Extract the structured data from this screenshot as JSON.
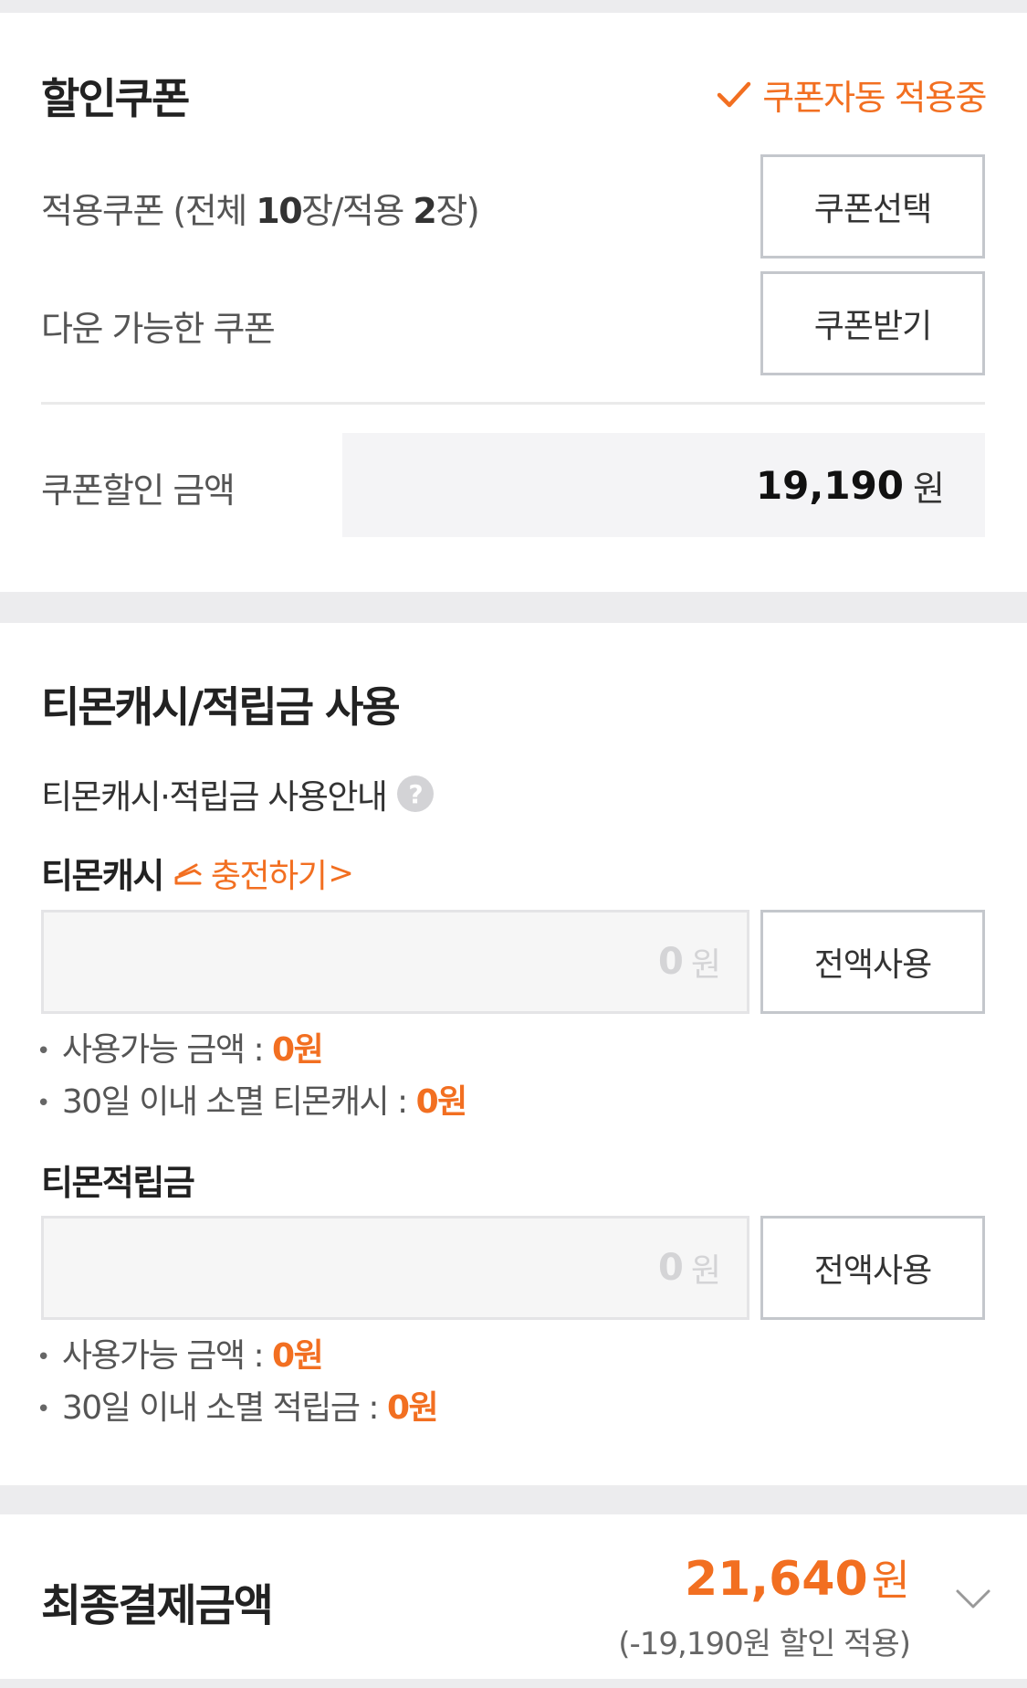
{
  "coupon": {
    "title": "할인쿠폰",
    "auto_apply_label": "쿠폰자동 적용중",
    "applied_prefix": "적용쿠폰 (전체 ",
    "applied_total": "10",
    "applied_mid": "장/적용 ",
    "applied_count": "2",
    "applied_suffix": "장)",
    "select_button": "쿠폰선택",
    "download_label": "다운 가능한 쿠폰",
    "receive_button": "쿠폰받기",
    "discount_label": "쿠폰할인 금액",
    "discount_amount": "19,190",
    "discount_unit": "원"
  },
  "cash": {
    "title": "티몬캐시/적립금 사용",
    "guide_label": "티몬캐시·적립금 사용안내",
    "help_icon_text": "?",
    "tmon_cash": {
      "label": "티몬캐시",
      "charge_link": "충전하기",
      "charge_arrow": ">",
      "input_value": "0",
      "input_unit": "원",
      "use_all_button": "전액사용",
      "available_label": "사용가능 금액 : ",
      "available_value": "0원",
      "expiring_label": "30일 이내 소멸 티몬캐시 : ",
      "expiring_value": "0원"
    },
    "tmon_points": {
      "label": "티몬적립금",
      "input_value": "0",
      "input_unit": "원",
      "use_all_button": "전액사용",
      "available_label": "사용가능 금액 : ",
      "available_value": "0원",
      "expiring_label": "30일 이내 소멸 적립금 : ",
      "expiring_value": "0원"
    }
  },
  "final": {
    "title": "최종결제금액",
    "amount": "21,640",
    "amount_unit": "원",
    "discount_note": "(-19,190원 할인 적용)"
  },
  "colors": {
    "accent": "#f26f21",
    "background": "#ececee",
    "border": "#c4c7cc"
  },
  "icons": [
    "check-icon",
    "help-icon",
    "charge-icon",
    "chevron-down-icon"
  ]
}
